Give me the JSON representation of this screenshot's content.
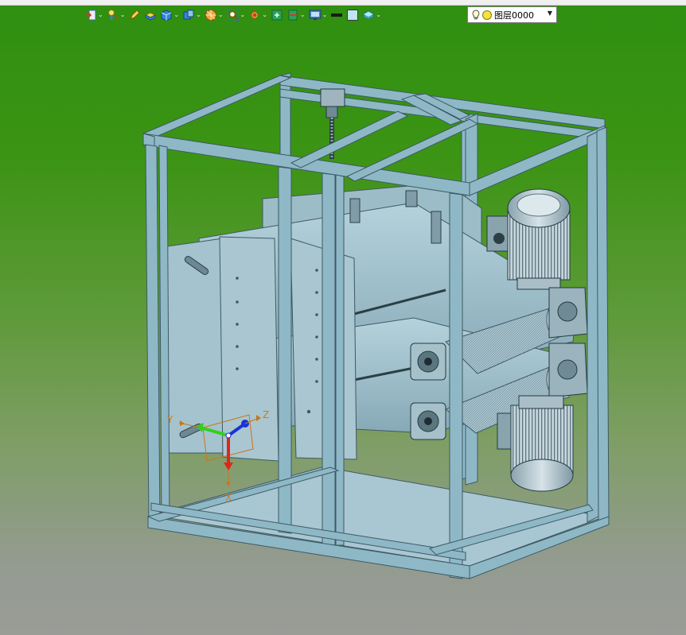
{
  "toolbar": {
    "icons": [
      {
        "name": "import-icon",
        "has_dropdown": true
      },
      {
        "name": "light-icon",
        "has_dropdown": true
      },
      {
        "name": "pen-icon",
        "has_dropdown": false
      },
      {
        "name": "shade-icon",
        "has_dropdown": false
      },
      {
        "name": "solid-view-icon",
        "has_dropdown": true
      },
      {
        "name": "view-cube-icon",
        "has_dropdown": true
      },
      {
        "name": "render-mode-icon",
        "has_dropdown": true
      },
      {
        "name": "zoom-icon",
        "has_dropdown": true
      },
      {
        "name": "pan-axis-icon",
        "has_dropdown": true
      },
      {
        "name": "fit-view-icon",
        "has_dropdown": false
      },
      {
        "name": "section-icon",
        "has_dropdown": true
      },
      {
        "name": "display-settings-icon",
        "has_dropdown": true
      },
      {
        "name": "line-color-icon",
        "has_dropdown": false
      },
      {
        "name": "fill-color-icon",
        "has_dropdown": false
      },
      {
        "name": "layer-tool-icon",
        "has_dropdown": true
      }
    ],
    "dropdown_glyph": "⌄"
  },
  "layer": {
    "label": "图层0000",
    "arrow": "▼",
    "bulb_color": "#f5e23c"
  },
  "triad": {
    "x_label": "X",
    "y_label": "Y",
    "z_label": "Z",
    "colors": {
      "x": "#e0261b",
      "y": "#2fd21a",
      "z": "#1c31d8",
      "label": "#d07a1c"
    }
  },
  "colors": {
    "frame": "#8fb8c7",
    "frame_dark": "#5f8a99",
    "belt": "#9fc0cc",
    "motor": "#b9cbd3",
    "background_top": "#2f8f10",
    "background_bottom": "#9a9c97"
  }
}
